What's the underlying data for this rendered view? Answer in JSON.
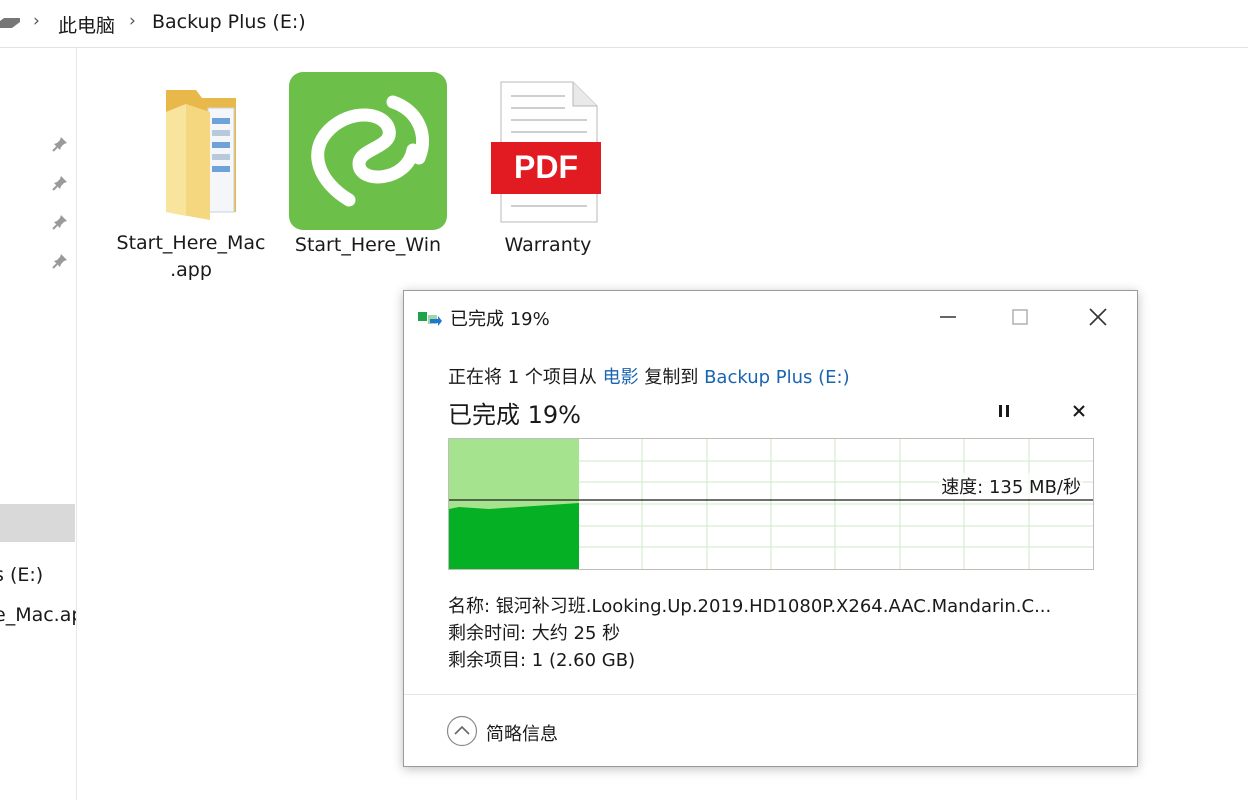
{
  "breadcrumb": {
    "items": [
      "此电脑",
      "Backup Plus (E:)"
    ]
  },
  "nav": {
    "partial_items": [
      "s (E:)",
      "e_Mac.ap"
    ]
  },
  "files": [
    {
      "name": "Start_Here_Mac\n.app",
      "icon": "folder-icon"
    },
    {
      "name": "Start_Here_Win",
      "icon": "seagate-logo-icon"
    },
    {
      "name": "Warranty",
      "icon": "pdf-file-icon",
      "badge": "PDF"
    }
  ],
  "dialog": {
    "title": "已完成 19%",
    "desc_prefix": "正在将 1 个项目从 ",
    "source": "电影",
    "desc_middle": " 复制到 ",
    "destination": "Backup Plus (E:)",
    "percent_label": "已完成 19%",
    "progress": 0.19,
    "speed": "速度: 135 MB/秒",
    "name_line": "名称: 银河补习班.Looking.Up.2019.HD1080P.X264.AAC.Mandarin.C...",
    "time_line": "剩余时间: 大约 25 秒",
    "items_line": "剩余项目: 1 (2.60 GB)",
    "less_details": "简略信息"
  },
  "colors": {
    "link": "#1a64b0",
    "progress_dark": "#06b025",
    "progress_light": "#a6e38f",
    "seagate_green": "#6cc04a",
    "pdf_red": "#e21b23",
    "folder_yellow": "#f5d77f"
  }
}
